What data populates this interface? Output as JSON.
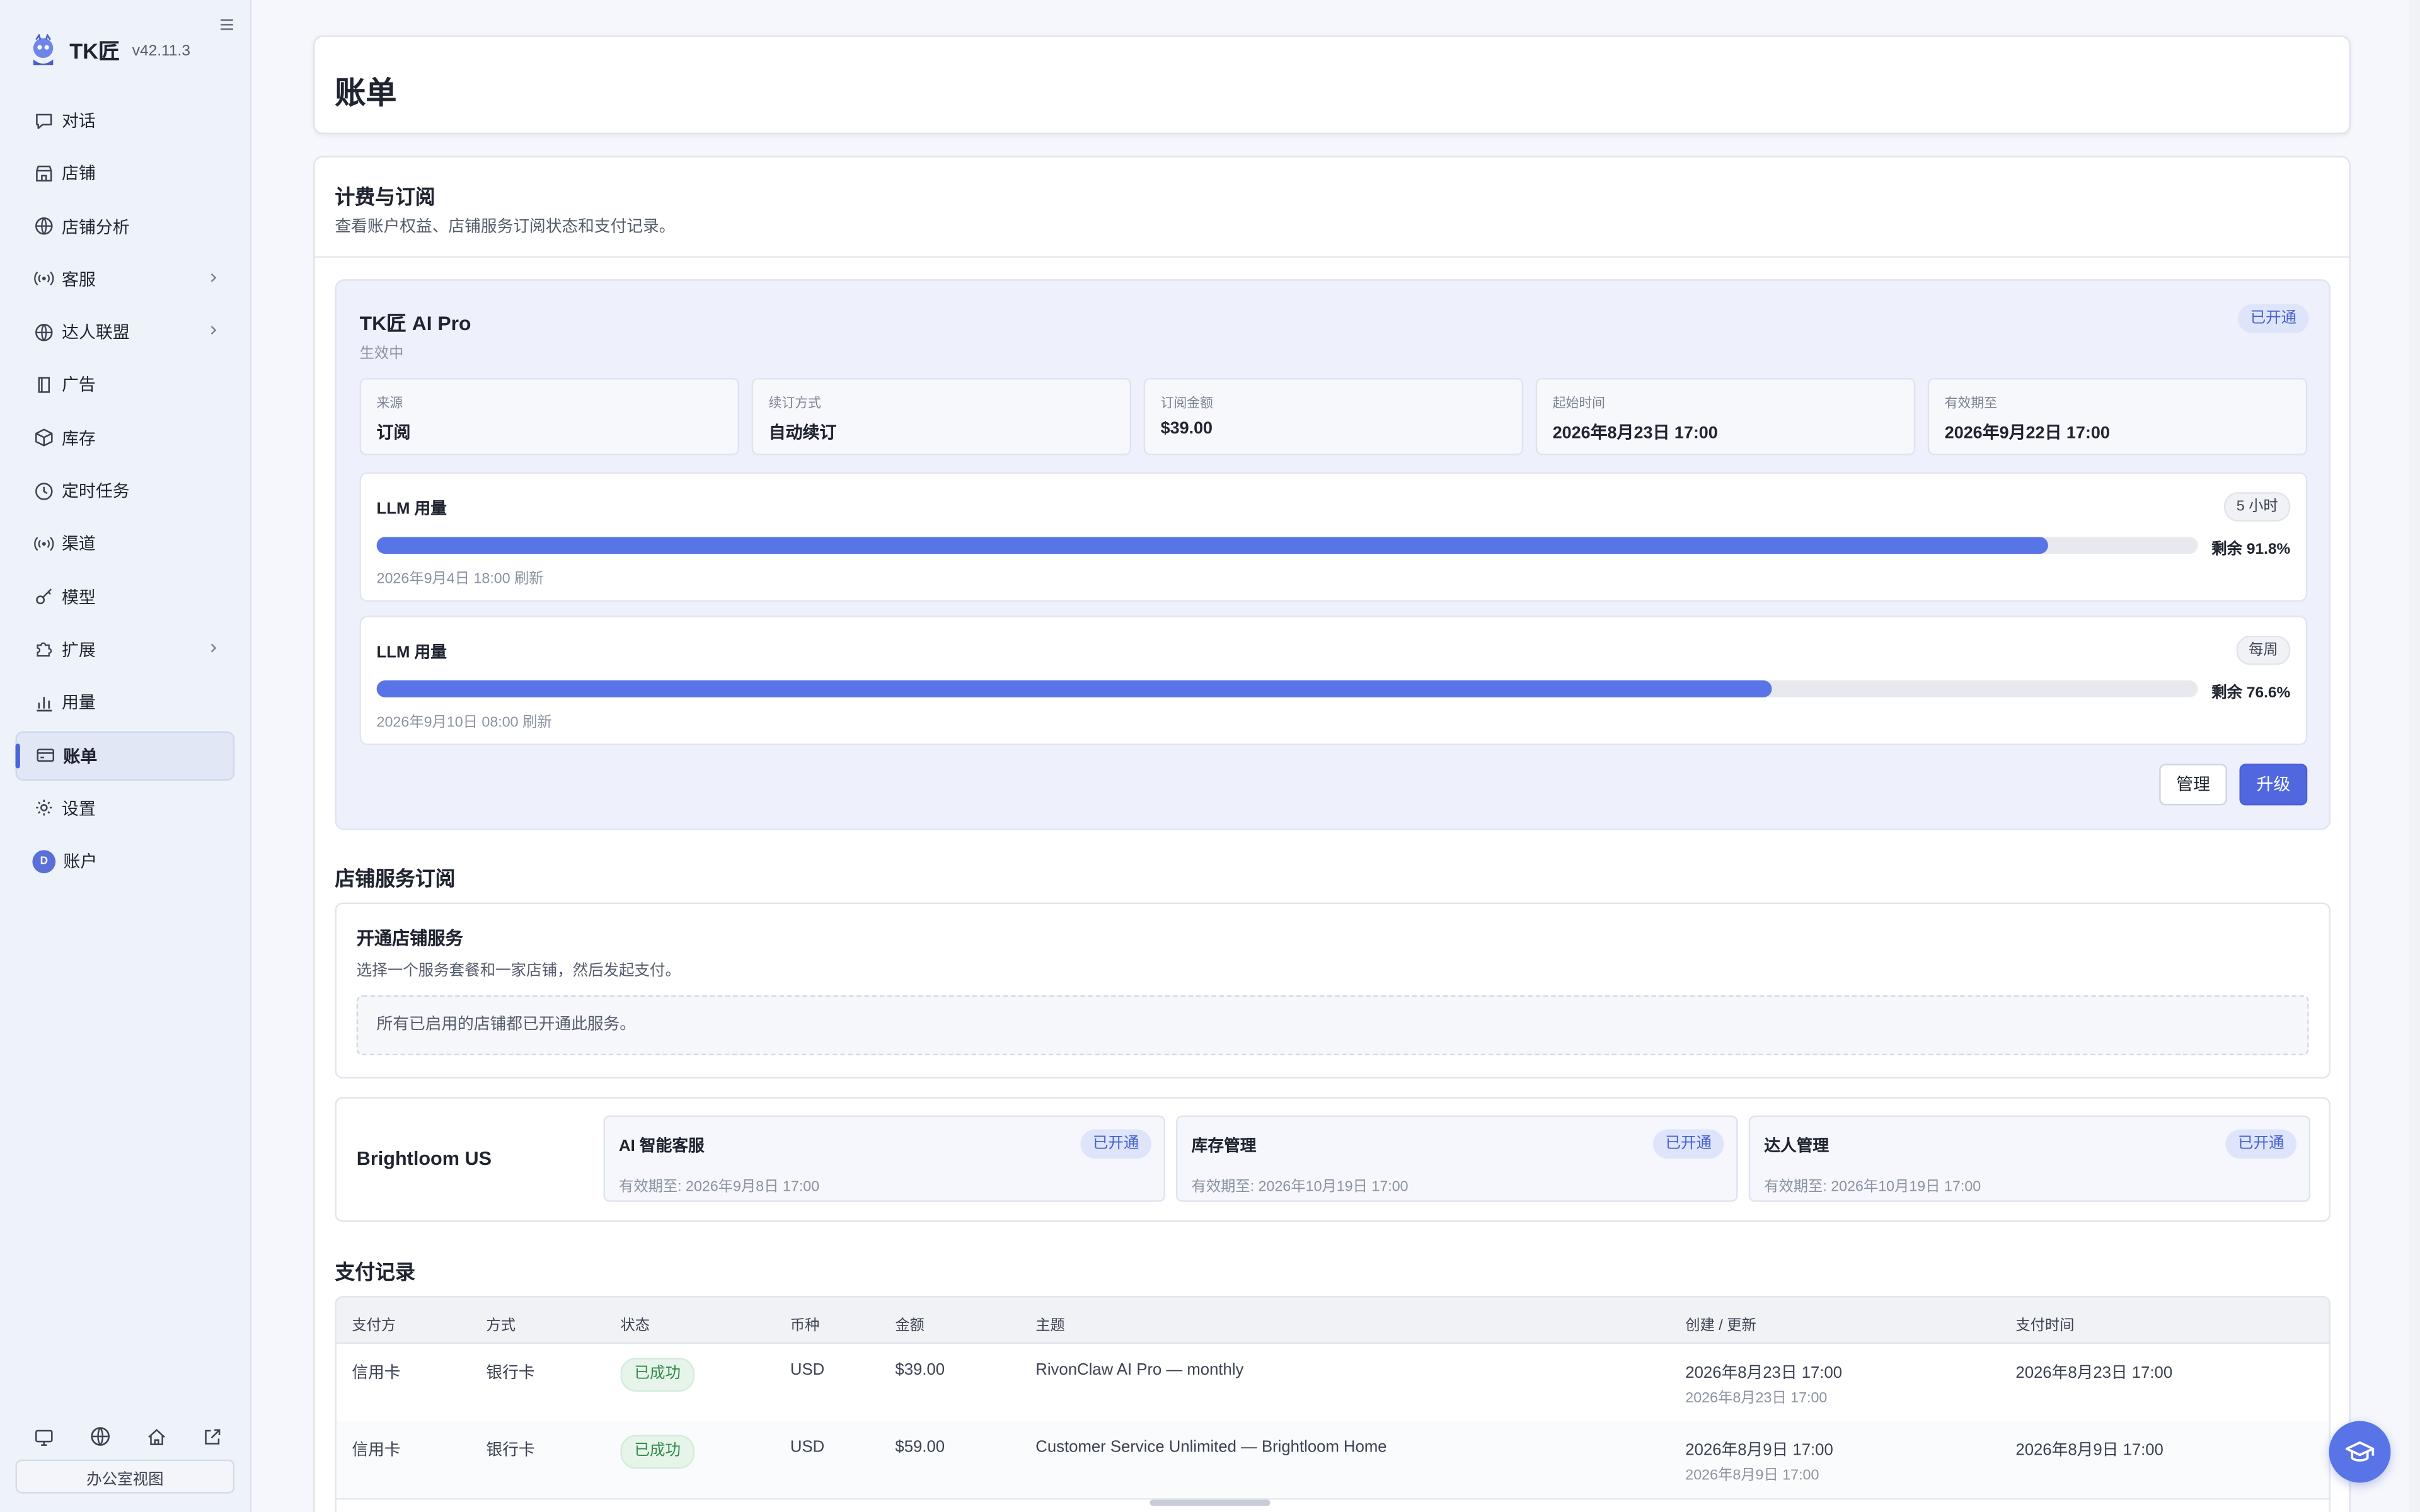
{
  "app": {
    "name": "TK匠",
    "version": "v42.11.3"
  },
  "sidebar": {
    "items": [
      {
        "label": "对话",
        "icon": "chat-icon"
      },
      {
        "label": "店铺",
        "icon": "store-icon"
      },
      {
        "label": "店铺分析",
        "icon": "globe-icon"
      },
      {
        "label": "客服",
        "icon": "broadcast-icon",
        "chevron": true
      },
      {
        "label": "达人联盟",
        "icon": "globe-icon",
        "chevron": true
      },
      {
        "label": "广告",
        "icon": "book-icon"
      },
      {
        "label": "库存",
        "icon": "box-icon"
      },
      {
        "label": "定时任务",
        "icon": "clock-icon"
      },
      {
        "label": "渠道",
        "icon": "broadcast-icon"
      },
      {
        "label": "模型",
        "icon": "key-icon"
      },
      {
        "label": "扩展",
        "icon": "puzzle-icon",
        "chevron": true
      },
      {
        "label": "用量",
        "icon": "bar-chart-icon"
      },
      {
        "label": "账单",
        "icon": "credit-card-icon",
        "active": true
      },
      {
        "label": "设置",
        "icon": "gear-icon"
      },
      {
        "label": "账户",
        "icon": "avatar",
        "avatar_letter": "D"
      }
    ],
    "footer_icons": [
      "monitor-icon",
      "globe-icon",
      "home-icon",
      "external-link-icon"
    ],
    "office_view": "办公室视图"
  },
  "page": {
    "title": "账单"
  },
  "billing": {
    "heading": "计费与订阅",
    "description": "查看账户权益、店铺服务订阅状态和支付记录。",
    "plan": {
      "name": "TK匠 AI Pro",
      "status": "生效中",
      "badge": "已开通",
      "info": [
        {
          "label": "来源",
          "value": "订阅"
        },
        {
          "label": "续订方式",
          "value": "自动续订"
        },
        {
          "label": "订阅金额",
          "value": "$39.00"
        },
        {
          "label": "起始时间",
          "value": "2026年8月23日 17:00"
        },
        {
          "label": "有效期至",
          "value": "2026年9月22日 17:00"
        }
      ],
      "usage": [
        {
          "title": "LLM 用量",
          "tag": "5 小时",
          "remaining_label": "剩余 91.8%",
          "fill_percent": 91.8,
          "reset": "2026年9月4日 18:00 刷新"
        },
        {
          "title": "LLM 用量",
          "tag": "每周",
          "remaining_label": "剩余 76.6%",
          "fill_percent": 76.6,
          "reset": "2026年9月10日 08:00 刷新"
        }
      ],
      "manage_label": "管理",
      "upgrade_label": "升级"
    },
    "store_services": {
      "heading": "店铺服务订阅",
      "open": {
        "title": "开通店铺服务",
        "description": "选择一个服务套餐和一家店铺，然后发起支付。",
        "note": "所有已启用的店铺都已开通此服务。"
      },
      "store": {
        "name": "Brightloom US",
        "services": [
          {
            "name": "AI 智能客服",
            "badge": "已开通",
            "expiry": "有效期至: 2026年9月8日 17:00"
          },
          {
            "name": "库存管理",
            "badge": "已开通",
            "expiry": "有效期至: 2026年10月19日 17:00"
          },
          {
            "name": "达人管理",
            "badge": "已开通",
            "expiry": "有效期至: 2026年10月19日 17:00"
          }
        ]
      }
    },
    "payments": {
      "heading": "支付记录",
      "columns": [
        "支付方",
        "方式",
        "状态",
        "币种",
        "金额",
        "主题",
        "创建 / 更新",
        "支付时间"
      ],
      "rows": [
        {
          "payer": "信用卡",
          "method": "银行卡",
          "status": "已成功",
          "currency": "USD",
          "amount": "$39.00",
          "subject": "RivonClaw AI Pro — monthly",
          "created": "2026年8月23日 17:00",
          "updated": "2026年8月23日 17:00",
          "paid": "2026年8月23日 17:00"
        },
        {
          "payer": "信用卡",
          "method": "银行卡",
          "status": "已成功",
          "currency": "USD",
          "amount": "$59.00",
          "subject": "Customer Service Unlimited — Brightloom Home",
          "created": "2026年8月9日 17:00",
          "updated": "2026年8月9日 17:00",
          "paid": "2026年8月9日 17:00"
        }
      ]
    }
  },
  "colors": {
    "accent": "#5874e6",
    "badge_bg": "#dee5fb",
    "success": "#2f8a48"
  }
}
